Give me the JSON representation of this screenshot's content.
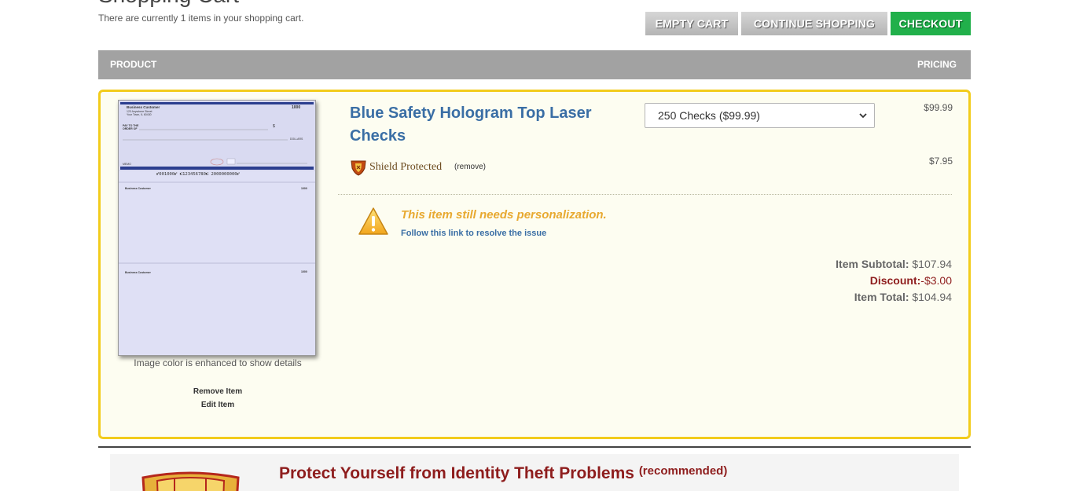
{
  "page": {
    "title": "Shopping Cart",
    "cart_count_text": "There are currently 1 items in your shopping cart."
  },
  "buttons": {
    "empty_cart": "EMPTY CART",
    "continue_shopping": "CONTINUE SHOPPING",
    "checkout": "CHECKOUT"
  },
  "table": {
    "product_header": "PRODUCT",
    "pricing_header": "PRICING"
  },
  "item": {
    "name": "Blue Safety Hologram Top Laser Checks",
    "quantity_selected": "250 Checks ($99.99)",
    "price": "$99.99",
    "image_note": "Image color is enhanced to show details",
    "remove_label": "Remove Item",
    "edit_label": "Edit Item",
    "check_preview": {
      "company": "Business Customer",
      "address_line1": "123 Anywhere Street",
      "address_line2": "Your Town, IL 60430",
      "check_number": "1000",
      "pay_to": "PAY TO THE",
      "order_of": "ORDER OF",
      "dollar_sign": "$",
      "dollars": "DOLLARS",
      "memo": "MEMO",
      "micr": "⑈001000⑈ ⑆123456780⑆ 2000000000⑈",
      "stub1_company": "Business Customer",
      "stub1_number": "1000",
      "stub2_company": "Business Customer",
      "stub2_number": "1000"
    },
    "shield": {
      "logo_text": "Shield Protected",
      "remove_label": "(remove)",
      "price": "$7.95"
    },
    "warning": {
      "message": "This item still needs personalization.",
      "link": "Follow this link to resolve the issue"
    },
    "totals": {
      "subtotal_label": "Item Subtotal:",
      "subtotal_value": "$107.94",
      "discount_label": "Discount:",
      "discount_value": "-$3.00",
      "total_label": "Item Total:",
      "total_value": "$104.94"
    }
  },
  "promo": {
    "title": "Protect Yourself from Identity Theft Problems",
    "tag": "(recommended)"
  },
  "colors": {
    "checkout_green": "#21b04b",
    "item_border": "#f2cc1c",
    "product_blue": "#3a6ea5",
    "warning_orange": "#e8a930",
    "promo_red": "#8e1d1d"
  }
}
